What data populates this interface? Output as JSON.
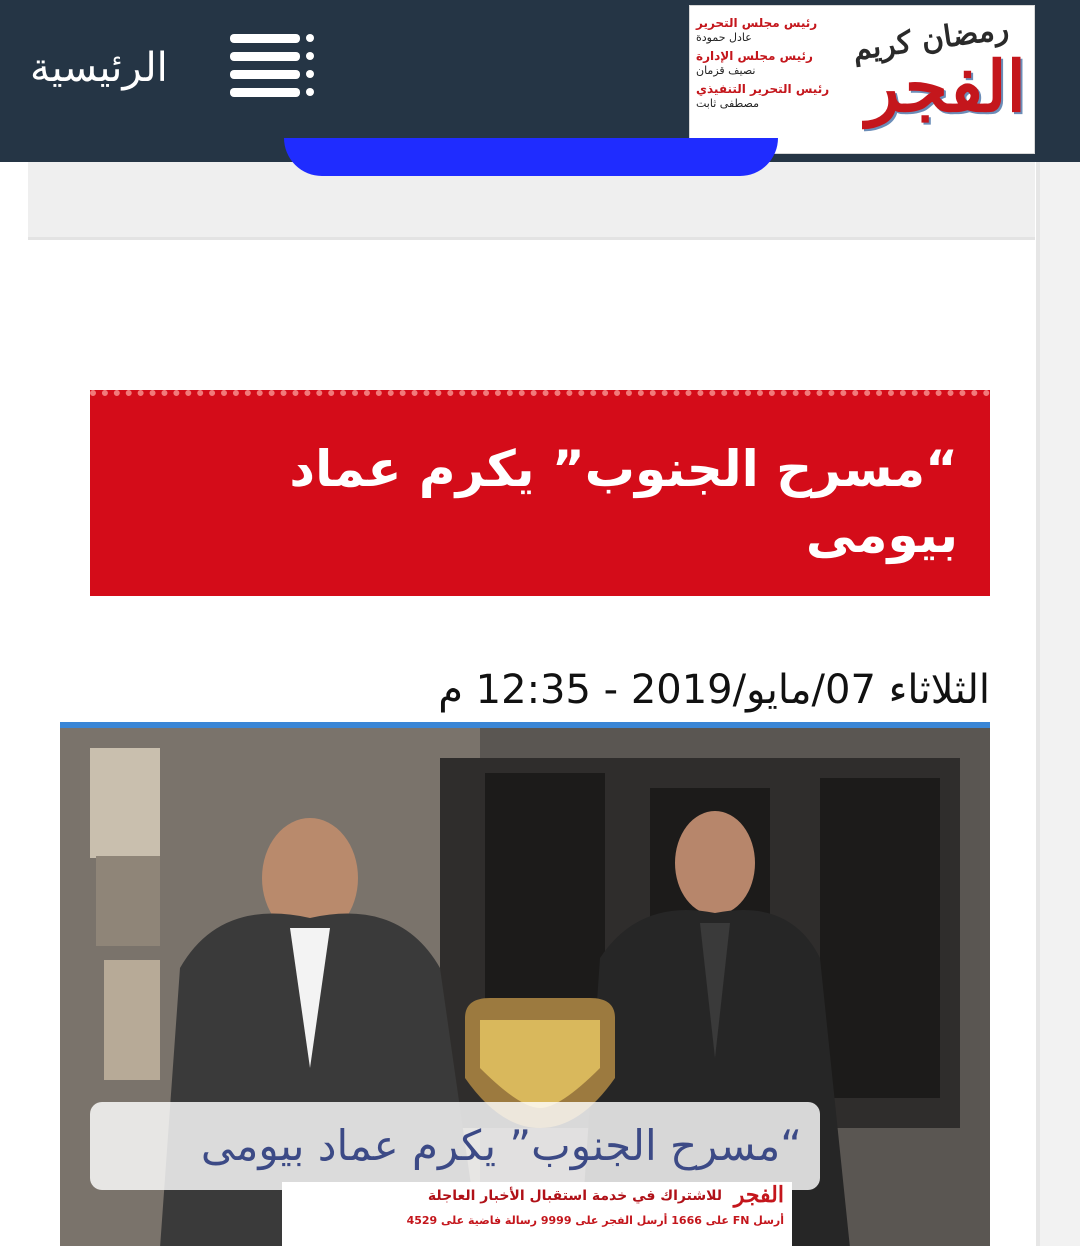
{
  "header": {
    "home_label": "الرئيسية",
    "logo": {
      "brand": "الفجر",
      "ramadan": "رمضان كريم",
      "credits": [
        {
          "title": "رئيس مجلس التحرير",
          "name": "عادل حمودة"
        },
        {
          "title": "رئيس مجلس الإدارة",
          "name": "نصيف قزمان"
        },
        {
          "title": "رئيس التحرير التنفيذي",
          "name": "مصطفى ثابت"
        }
      ]
    },
    "menu_icon": "hamburger-menu-icon"
  },
  "article": {
    "title": "“مسرح الجنوب” يكرم عماد بيومى",
    "date": "الثلاثاء 07/مايو/2019 - 12:35 م",
    "image_caption": "“مسرح الجنوب” يكرم عماد بيومى",
    "image_banner": {
      "logo": "الفجر",
      "line1": "للاشتراك في خدمة استقبال الأخبار العاجلة",
      "line2": "أرسل FN على 1666 أرسل الفجر على 9999 رسالة فاضية على 4529"
    }
  },
  "colors": {
    "header_bg": "#253545",
    "title_bg": "#d40c19",
    "accent_blue": "#1f2cff",
    "image_border": "#3a86d6"
  }
}
